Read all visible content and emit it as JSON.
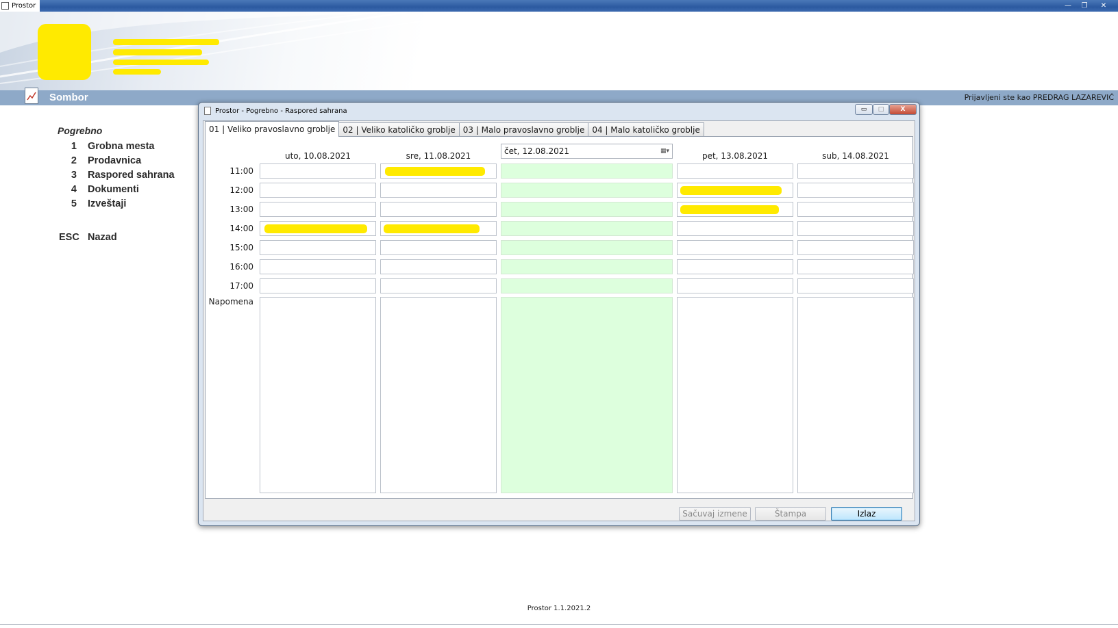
{
  "window": {
    "title": "Prostor",
    "controls": {
      "minimize": "—",
      "maximize": "❐",
      "close": "✕"
    }
  },
  "location": {
    "city": "Sombor",
    "login_status": "Prijavljeni ste kao PREDRAG LAZAREVIĆ"
  },
  "menu": {
    "section_title": "Pogrebno",
    "items": [
      {
        "key": "1",
        "label": "Grobna mesta"
      },
      {
        "key": "2",
        "label": "Prodavnica"
      },
      {
        "key": "3",
        "label": "Raspored sahrana"
      },
      {
        "key": "4",
        "label": "Dokumenti"
      },
      {
        "key": "5",
        "label": "Izveštaji"
      }
    ],
    "back": {
      "key": "ESC",
      "label": "Nazad"
    }
  },
  "dialog": {
    "title": "Prostor - Pogrebno - Raspored sahrana",
    "controls": {
      "minimize": "▭",
      "maximize": "□",
      "close": "X"
    },
    "tabs": [
      {
        "label": "01 | Veliko pravoslavno groblje",
        "active": true
      },
      {
        "label": "02 | Veliko katoličko groblje",
        "active": false
      },
      {
        "label": "03 | Malo pravoslavno groblje",
        "active": false
      },
      {
        "label": "04 | Malo katoličko groblje",
        "active": false
      }
    ],
    "days": [
      {
        "label": "uto, 10.08.2021",
        "selected": false
      },
      {
        "label": "sre, 11.08.2021",
        "selected": false
      },
      {
        "label": "čet, 12.08.2021",
        "selected": true
      },
      {
        "label": "pet, 13.08.2021",
        "selected": false
      },
      {
        "label": "sub, 14.08.2021",
        "selected": false
      }
    ],
    "times": [
      "11:00",
      "12:00",
      "13:00",
      "14:00",
      "15:00",
      "16:00",
      "17:00"
    ],
    "note_label": "Napomena",
    "calendar_icon": "▦▾",
    "buttons": {
      "save": "Sačuvaj izmene",
      "print": "Štampa",
      "exit": "Izlaz"
    }
  },
  "colors": {
    "today_cell": "#ddffdd",
    "redaction": "#ffea00",
    "location_bar": "#8ea9c8"
  },
  "footer": {
    "version": "Prostor 1.1.2021.2"
  }
}
